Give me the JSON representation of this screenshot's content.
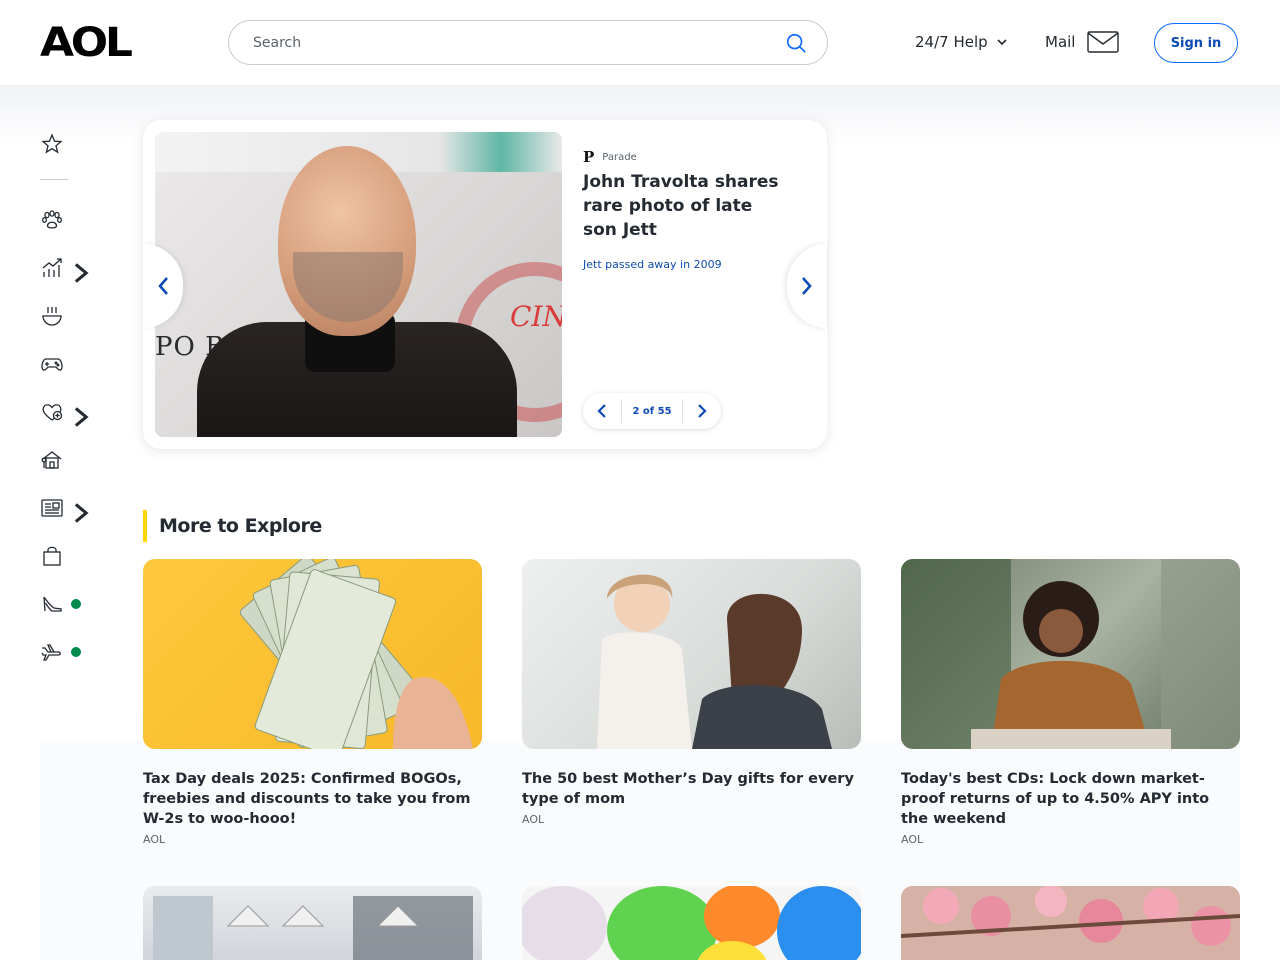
{
  "header": {
    "logo": "AOL",
    "search_placeholder": "Search",
    "help_label": "24/7 Help",
    "mail_label": "Mail",
    "signin_label": "Sign in"
  },
  "sidebar": {
    "items": [
      {
        "icon": "star-icon"
      },
      {
        "icon": "paw-icon"
      },
      {
        "icon": "chart-icon",
        "has_chevron": true
      },
      {
        "icon": "bowl-icon"
      },
      {
        "icon": "gamepad-icon"
      },
      {
        "icon": "heart-plus-icon",
        "has_chevron": true
      },
      {
        "icon": "home-icon"
      },
      {
        "icon": "newspaper-icon",
        "has_chevron": true
      },
      {
        "icon": "shopping-bag-icon"
      },
      {
        "icon": "high-heel-icon",
        "badge_color": "#008a4e"
      },
      {
        "icon": "plane-icon",
        "badge_color": "#008a4e"
      }
    ]
  },
  "carousel": {
    "source_logo": "P",
    "source_name": "Parade",
    "title": "John Travolta shares rare photo of late son Jett",
    "subtitle": "Jett passed away in 2009",
    "pager": "2 of 55",
    "image_text_left": "PO BN",
    "image_text_right": "CIN"
  },
  "explore": {
    "title": "More to Explore",
    "tiles": [
      {
        "title": "Tax Day deals 2025: Confirmed BOGOs, freebies and discounts to take you from W-2s to woo-hooo!",
        "source": "AOL"
      },
      {
        "title": "The 50 best Mother’s Day gifts for every type of mom",
        "source": "AOL"
      },
      {
        "title": "Today's best CDs: Lock down market-proof returns of up to 4.50% APY into the weekend",
        "source": "AOL"
      }
    ]
  },
  "colors": {
    "accent": "#0f4bb5",
    "explore_bar": "#ffd600",
    "badge": "#008a4e"
  }
}
